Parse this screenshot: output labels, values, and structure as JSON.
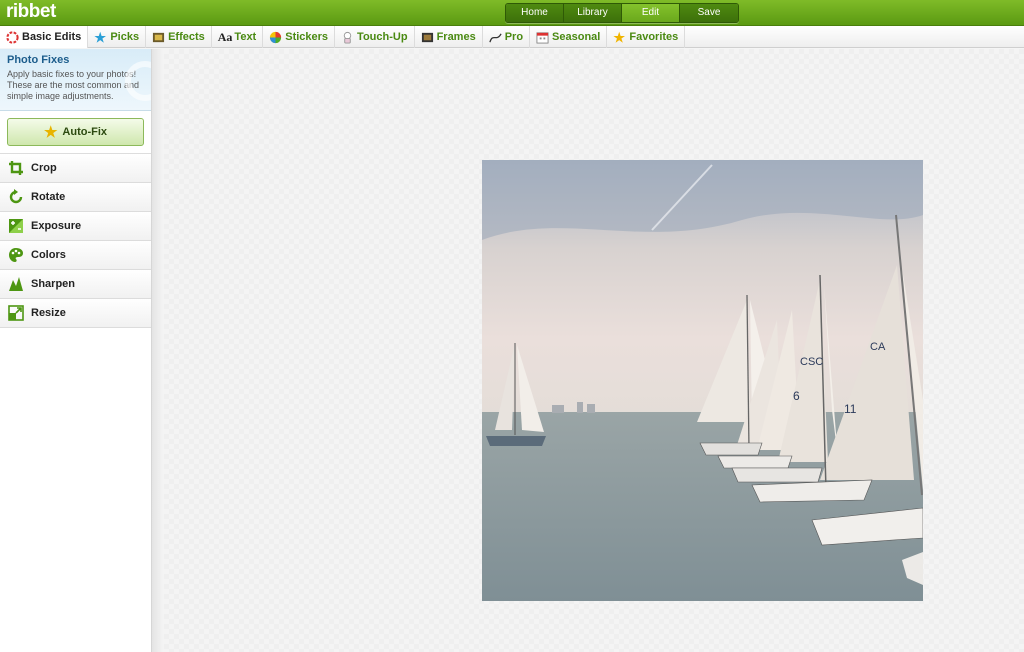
{
  "app": {
    "logo": "ribbet"
  },
  "main_nav": [
    {
      "label": "Home",
      "active": false
    },
    {
      "label": "Library",
      "active": false
    },
    {
      "label": "Edit",
      "active": true
    },
    {
      "label": "Save",
      "active": false
    }
  ],
  "tabs": [
    {
      "label": "Basic Edits",
      "icon": "aperture-icon",
      "active": true
    },
    {
      "label": "Picks",
      "icon": "star-icon",
      "active": false
    },
    {
      "label": "Effects",
      "icon": "film-icon",
      "active": false
    },
    {
      "label": "Text",
      "icon": "text-aa-icon",
      "active": false
    },
    {
      "label": "Stickers",
      "icon": "beach-ball-icon",
      "active": false
    },
    {
      "label": "Touch-Up",
      "icon": "bottle-icon",
      "active": false
    },
    {
      "label": "Frames",
      "icon": "frame-icon",
      "active": false
    },
    {
      "label": "Pro",
      "icon": "curve-icon",
      "active": false
    },
    {
      "label": "Seasonal",
      "icon": "calendar-icon",
      "active": false
    },
    {
      "label": "Favorites",
      "icon": "star-icon",
      "active": false
    }
  ],
  "panel": {
    "title": "Photo Fixes",
    "description": "Apply basic fixes to your photos! These are the most common and simple image adjustments.",
    "autofix_label": "Auto-Fix"
  },
  "tools": [
    {
      "label": "Crop",
      "icon": "crop-icon"
    },
    {
      "label": "Rotate",
      "icon": "rotate-icon"
    },
    {
      "label": "Exposure",
      "icon": "exposure-icon"
    },
    {
      "label": "Colors",
      "icon": "palette-icon"
    },
    {
      "label": "Sharpen",
      "icon": "sharpen-icon"
    },
    {
      "label": "Resize",
      "icon": "resize-icon"
    }
  ],
  "colors": {
    "brand_green": "#6aa81c",
    "tab_green": "#4a8a12",
    "panel_blue": "#1c5d8c"
  }
}
